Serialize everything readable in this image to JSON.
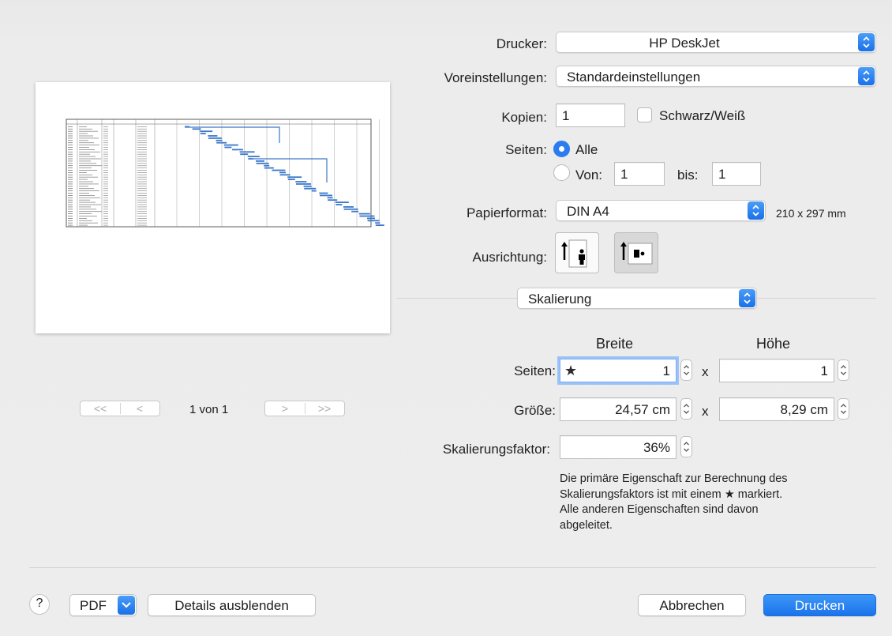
{
  "printer": {
    "label": "Drucker:",
    "value": "HP DeskJet"
  },
  "presets": {
    "label": "Voreinstellungen:",
    "value": "Standardeinstellungen"
  },
  "copies": {
    "label": "Kopien:",
    "value": "1",
    "bw_label": "Schwarz/Weiß"
  },
  "pages": {
    "label": "Seiten:",
    "all_label": "Alle",
    "from_label": "Von:",
    "from_value": "1",
    "to_label": "bis:",
    "to_value": "1"
  },
  "paper": {
    "label": "Papierformat:",
    "value": "DIN A4",
    "dimensions": "210 x 297 mm"
  },
  "orientation": {
    "label": "Ausrichtung:",
    "selected": "landscape"
  },
  "section_popup": {
    "value": "Skalierung"
  },
  "scaling": {
    "width_header": "Breite",
    "height_header": "Höhe",
    "pages_label": "Seiten:",
    "pages_width": "1",
    "pages_height": "1",
    "size_label": "Größe:",
    "size_width": "24,57 cm",
    "size_height": "8,29 cm",
    "times": "x",
    "factor_label": "Skalierungsfaktor:",
    "factor_value": "36%",
    "star": "★",
    "info_lines": [
      "Die primäre Eigenschaft zur Berechnung des",
      "Skalierungsfaktors ist mit einem ★ markiert.",
      "Alle anderen Eigenschaften sind davon",
      "abgeleitet."
    ]
  },
  "preview_nav": {
    "first": "<<",
    "prev": "<",
    "page_text": "1 von 1",
    "next": ">",
    "last": ">>"
  },
  "footer": {
    "help": "?",
    "pdf": "PDF",
    "details": "Details ausblenden",
    "cancel": "Abbrechen",
    "print": "Drucken"
  },
  "colors": {
    "accent": "#1b73ea",
    "gantt_bar": "#3a78c9"
  }
}
